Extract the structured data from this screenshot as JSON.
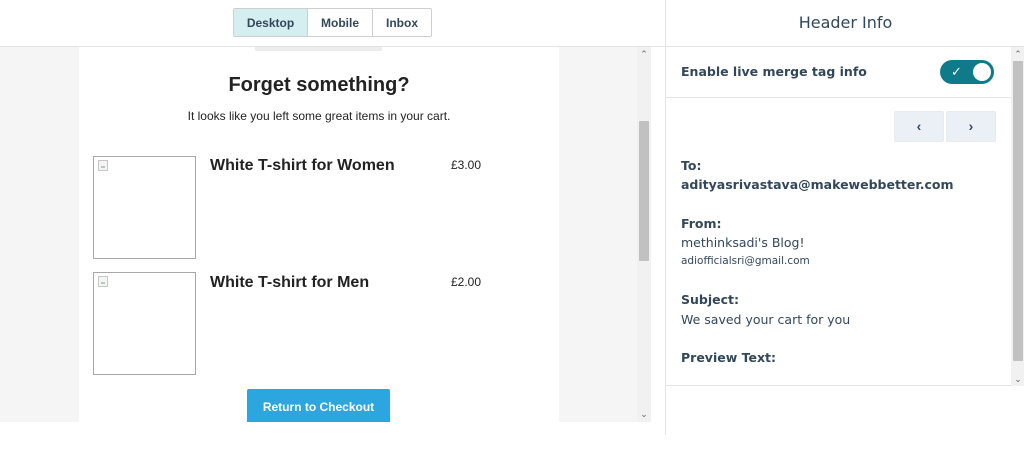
{
  "view_tabs": {
    "desktop": "Desktop",
    "mobile": "Mobile",
    "inbox": "Inbox",
    "active": "Desktop"
  },
  "email": {
    "heading": "Forget something?",
    "lead": "It looks like you left some great items in your cart.",
    "items": [
      {
        "name": "White T-shirt for Women",
        "price": "£3.00"
      },
      {
        "name": "White T-shirt for Men",
        "price": "£2.00"
      }
    ],
    "cta_label": "Return to Checkout",
    "cta_color": "#2ba6de"
  },
  "header_info": {
    "title": "Header Info",
    "toggle_label": "Enable live merge tag info",
    "toggle_on": true,
    "toggle_color": "#0f7b8a",
    "prev_icon": "‹",
    "next_icon": "›",
    "to_label": "To:",
    "to_value": "adityasrivastava@makewebbetter.com",
    "from_label": "From:",
    "from_name": "methinksadi's Blog!",
    "from_email": "adiofficialsri@gmail.com",
    "subject_label": "Subject:",
    "subject_value": "We saved your cart for you",
    "preview_label": "Preview Text:"
  },
  "scroll_icons": {
    "up": "⌃",
    "down": "⌄"
  }
}
